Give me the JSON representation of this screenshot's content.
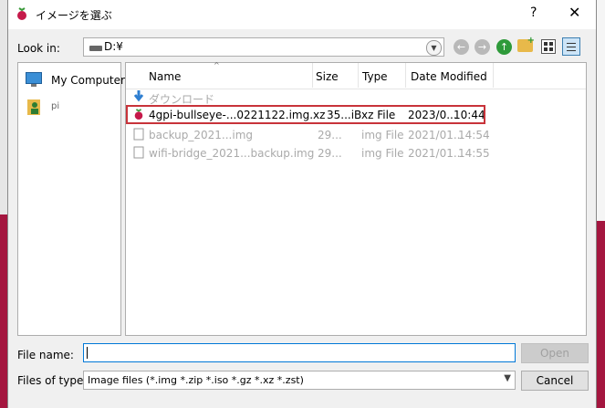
{
  "window": {
    "title": "イメージを選ぶ",
    "help": "?",
    "close": "✕"
  },
  "toolbar": {
    "look_in_label": "Look in:",
    "look_in_value": "D:¥"
  },
  "sidebar": {
    "items": [
      {
        "label": "My Computer"
      },
      {
        "label": "pi"
      }
    ]
  },
  "columns": {
    "name": "Name",
    "size": "Size",
    "type": "Type",
    "date": "Date Modified"
  },
  "files": [
    {
      "name": "ダウンロード",
      "size": "",
      "type": "",
      "date": ""
    },
    {
      "name": "4gpi-bullseye-...0221122.img.xz",
      "size": "35...iB",
      "type": "xz File",
      "date": "2023/0...",
      "time": "10:44"
    },
    {
      "name": "backup_2021...img",
      "size": "29...",
      "type": "img File",
      "date": "2021/01...",
      "time": "14:54"
    },
    {
      "name": "wifi-bridge_2021...backup.img",
      "size": "29...",
      "type": "img File",
      "date": "2021/01...",
      "time": "14:55"
    }
  ],
  "file_name": {
    "label": "File name:",
    "value": ""
  },
  "file_type": {
    "label": "Files of type:",
    "value": "Image files (*.img *.zip *.iso *.gz *.xz *.zst)"
  },
  "buttons": {
    "open": "Open",
    "cancel": "Cancel"
  },
  "colors": {
    "selection_border": "#c8333a",
    "accent": "#0078d7",
    "background_strip": "#a4163f"
  }
}
